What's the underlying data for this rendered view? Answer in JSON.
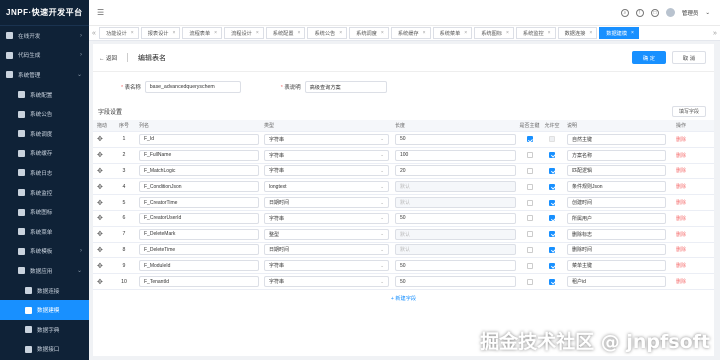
{
  "brand": "JNPF·快速开发平台",
  "sidebar": {
    "items": [
      {
        "label": "在线开发",
        "level": 0,
        "arrow": "›"
      },
      {
        "label": "代码生成",
        "level": 0,
        "arrow": "›"
      },
      {
        "label": "系统管理",
        "level": 0,
        "arrow": "⌄"
      },
      {
        "label": "系统配置",
        "level": 1
      },
      {
        "label": "系统公告",
        "level": 1
      },
      {
        "label": "系统调度",
        "level": 1
      },
      {
        "label": "系统缓存",
        "level": 1
      },
      {
        "label": "系统日志",
        "level": 1
      },
      {
        "label": "系统监控",
        "level": 1
      },
      {
        "label": "系统图标",
        "level": 1
      },
      {
        "label": "系统菜单",
        "level": 1
      },
      {
        "label": "系统模板",
        "level": 1,
        "arrow": "›"
      },
      {
        "label": "数据应用",
        "level": 1,
        "arrow": "⌄"
      },
      {
        "label": "数据连接",
        "level": 2
      },
      {
        "label": "数据建模",
        "level": 2,
        "active": true
      },
      {
        "label": "数据字典",
        "level": 2
      },
      {
        "label": "数据接口",
        "level": 2
      }
    ]
  },
  "topbar": {
    "user": "管理员"
  },
  "tabs": [
    {
      "label": "功能设计"
    },
    {
      "label": "报表设计"
    },
    {
      "label": "流程表单"
    },
    {
      "label": "流程设计"
    },
    {
      "label": "系统配置"
    },
    {
      "label": "系统公告"
    },
    {
      "label": "系统调度"
    },
    {
      "label": "系统缓存"
    },
    {
      "label": "系统菜单"
    },
    {
      "label": "系统图标"
    },
    {
      "label": "系统监控"
    },
    {
      "label": "数据连接"
    },
    {
      "label": "数据建模",
      "active": true
    }
  ],
  "header": {
    "back": "返回",
    "title": "编辑表名",
    "confirm": "确 定",
    "cancel": "取 消"
  },
  "form": {
    "table_label": "表名称",
    "table_value": "base_advancedqueryschem",
    "desc_label": "表说明",
    "desc_value": "高级查询方案"
  },
  "section": {
    "title": "字段设置",
    "button": "填写字段"
  },
  "columns": [
    "拖动",
    "序号",
    "列名",
    "类型",
    "长度",
    "是否主键",
    "允许空",
    "说明",
    "操作"
  ],
  "rows": [
    {
      "no": "1",
      "name": "F_Id",
      "type": "字符串",
      "len": "50",
      "pk": true,
      "nullable": false,
      "desc": "自然主键",
      "lenDis": false
    },
    {
      "no": "2",
      "name": "F_FullName",
      "type": "字符串",
      "len": "100",
      "pk": false,
      "nullable": true,
      "desc": "方案名称",
      "lenDis": false
    },
    {
      "no": "3",
      "name": "F_MatchLogic",
      "type": "字符串",
      "len": "20",
      "pk": false,
      "nullable": true,
      "desc": "匹配逻辑",
      "lenDis": false
    },
    {
      "no": "4",
      "name": "F_ConditionJson",
      "type": "longtext",
      "len": "默认",
      "pk": false,
      "nullable": true,
      "desc": "条件规则Json",
      "lenDis": true
    },
    {
      "no": "5",
      "name": "F_CreatorTime",
      "type": "日期时间",
      "len": "默认",
      "pk": false,
      "nullable": true,
      "desc": "创建时间",
      "lenDis": true
    },
    {
      "no": "6",
      "name": "F_CreatorUserId",
      "type": "字符串",
      "len": "50",
      "pk": false,
      "nullable": true,
      "desc": "所属用户",
      "lenDis": false
    },
    {
      "no": "7",
      "name": "F_DeleteMark",
      "type": "整型",
      "len": "默认",
      "pk": false,
      "nullable": true,
      "desc": "删除标志",
      "lenDis": true
    },
    {
      "no": "8",
      "name": "F_DeleteTime",
      "type": "日期时间",
      "len": "默认",
      "pk": false,
      "nullable": true,
      "desc": "删除时间",
      "lenDis": true
    },
    {
      "no": "9",
      "name": "F_ModuleId",
      "type": "字符串",
      "len": "50",
      "pk": false,
      "nullable": true,
      "desc": "菜单主键",
      "lenDis": false
    },
    {
      "no": "10",
      "name": "F_TenantId",
      "type": "字符串",
      "len": "50",
      "pk": false,
      "nullable": true,
      "desc": "租户id",
      "lenDis": false
    }
  ],
  "delete_label": "删除",
  "add_field": "+ 新建字段",
  "watermark": "掘金技术社区 @ jnpfsoft",
  "colors": {
    "sidebar": "#0f2237",
    "accent": "#1890ff",
    "danger": "#f56c6c"
  }
}
